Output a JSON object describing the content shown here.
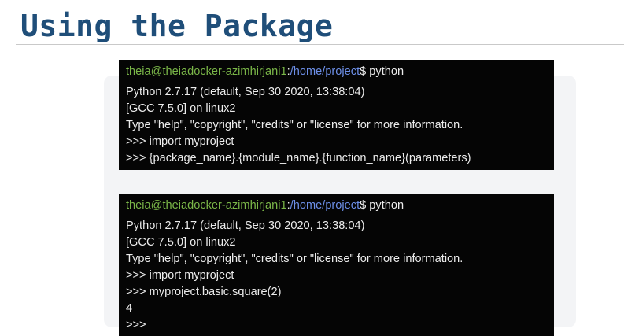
{
  "slide": {
    "title": "Using the Package"
  },
  "terminals": [
    {
      "prompt": {
        "user_host": "theia@theiadocker-azimhirjani1",
        "separator": ":",
        "path": "/home/project",
        "dollar": "$",
        "command": " python"
      },
      "lines": [
        "Python 2.7.17 (default, Sep 30 2020, 13:38:04)",
        "[GCC 7.5.0] on linux2",
        "Type \"help\", \"copyright\", \"credits\" or \"license\" for more information.",
        ">>> import myproject",
        ">>> {package_name}.{module_name}.{function_name}(parameters)"
      ]
    },
    {
      "prompt": {
        "user_host": "theia@theiadocker-azimhirjani1",
        "separator": ":",
        "path": "/home/project",
        "dollar": "$",
        "command": " python"
      },
      "lines": [
        "Python 2.7.17 (default, Sep 30 2020, 13:38:04)",
        "[GCC 7.5.0] on linux2",
        "Type \"help\", \"copyright\", \"credits\" or \"license\" for more information.",
        ">>> import myproject",
        ">>> myproject.basic.square(2)",
        "4",
        ">>>"
      ]
    }
  ],
  "colors": {
    "title": "#1f4e79",
    "terminal_bg": "#050505",
    "terminal_text": "#ececec",
    "prompt_user": "#7ab648",
    "prompt_path": "#6d8fe8"
  }
}
